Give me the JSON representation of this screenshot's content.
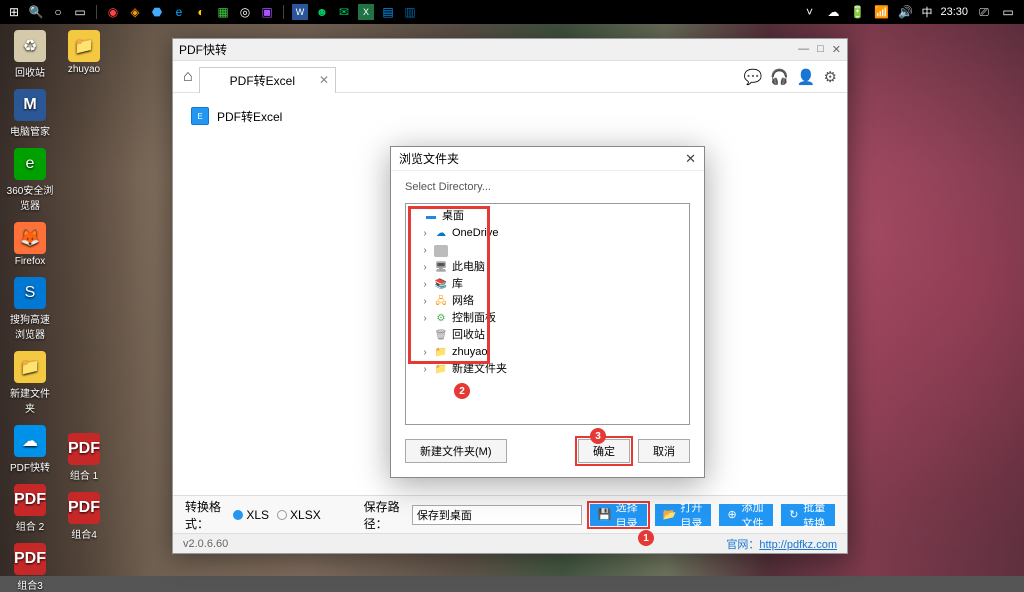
{
  "taskbar": {
    "time": "23:30",
    "ime": "中"
  },
  "desktop_icons_col1": [
    {
      "label": "回收站",
      "cls": "ico-recycle",
      "glyph": "♻"
    },
    {
      "label": "电脑管家",
      "cls": "ico-m",
      "glyph": "M"
    },
    {
      "label": "360安全浏览器",
      "cls": "ico-ie",
      "glyph": "e"
    },
    {
      "label": "Firefox",
      "cls": "ico-ff",
      "glyph": "🦊"
    },
    {
      "label": "搜狗高速浏览器",
      "cls": "ico-sogou",
      "glyph": "S"
    },
    {
      "label": "新建文件夹",
      "cls": "ico-folder",
      "glyph": "📁"
    },
    {
      "label": "PDF快转",
      "cls": "ico-pdf",
      "glyph": "☁"
    },
    {
      "label": "组合 2",
      "cls": "ico-pdfr",
      "glyph": "PDF"
    },
    {
      "label": "组合3",
      "cls": "ico-pdfr",
      "glyph": "PDF"
    }
  ],
  "desktop_icons_col2": [
    {
      "label": "zhuyao",
      "cls": "ico-folder",
      "glyph": "📁"
    },
    {
      "label": "",
      "cls": "",
      "glyph": ""
    },
    {
      "label": "",
      "cls": "",
      "glyph": ""
    },
    {
      "label": "",
      "cls": "",
      "glyph": ""
    },
    {
      "label": "",
      "cls": "",
      "glyph": ""
    },
    {
      "label": "",
      "cls": "",
      "glyph": ""
    },
    {
      "label": "",
      "cls": "",
      "glyph": ""
    },
    {
      "label": "组合 1",
      "cls": "ico-pdfr",
      "glyph": "PDF"
    },
    {
      "label": "组合4",
      "cls": "ico-pdfr",
      "glyph": "PDF"
    }
  ],
  "app": {
    "title": "PDF快转",
    "tab_label": "PDF转Excel",
    "file_label": "PDF转Excel",
    "format_label": "转换格式：",
    "radio_xls": "XLS",
    "radio_xlsx": "XLSX",
    "path_label": "保存路径：",
    "path_value": "保存到桌面",
    "btn_select": "选择目录",
    "btn_open": "打开目录",
    "btn_add": "添加文件",
    "btn_batch": "批量转换",
    "version": "v2.0.6.60",
    "official_label": "官网：",
    "official_url": "http://pdfkz.com"
  },
  "dialog": {
    "title": "浏览文件夹",
    "subtitle": "Select Directory...",
    "tree": [
      {
        "exp": "",
        "label": "桌面",
        "cls": "ti-desk",
        "glyph": "▬"
      },
      {
        "exp": "›",
        "label": "OneDrive",
        "cls": "ti-cloud",
        "glyph": "☁"
      },
      {
        "exp": "›",
        "label": "　",
        "cls": "ti-user",
        "glyph": ""
      },
      {
        "exp": "›",
        "label": "此电脑",
        "cls": "ti-pc",
        "glyph": "🖥"
      },
      {
        "exp": "›",
        "label": "库",
        "cls": "ti-lib",
        "glyph": "📚"
      },
      {
        "exp": "›",
        "label": "网络",
        "cls": "ti-net",
        "glyph": "🖧"
      },
      {
        "exp": "›",
        "label": "控制面板",
        "cls": "ti-cpl",
        "glyph": "⚙"
      },
      {
        "exp": "",
        "label": "回收站",
        "cls": "ti-rec",
        "glyph": "🗑"
      },
      {
        "exp": "›",
        "label": "zhuyao",
        "cls": "ti-fold",
        "glyph": "📁"
      },
      {
        "exp": "›",
        "label": "新建文件夹",
        "cls": "ti-fold",
        "glyph": "📁"
      }
    ],
    "btn_new": "新建文件夹(M)",
    "btn_ok": "确定",
    "btn_cancel": "取消"
  },
  "annotations": {
    "a1": "1",
    "a2": "2",
    "a3": "3"
  }
}
